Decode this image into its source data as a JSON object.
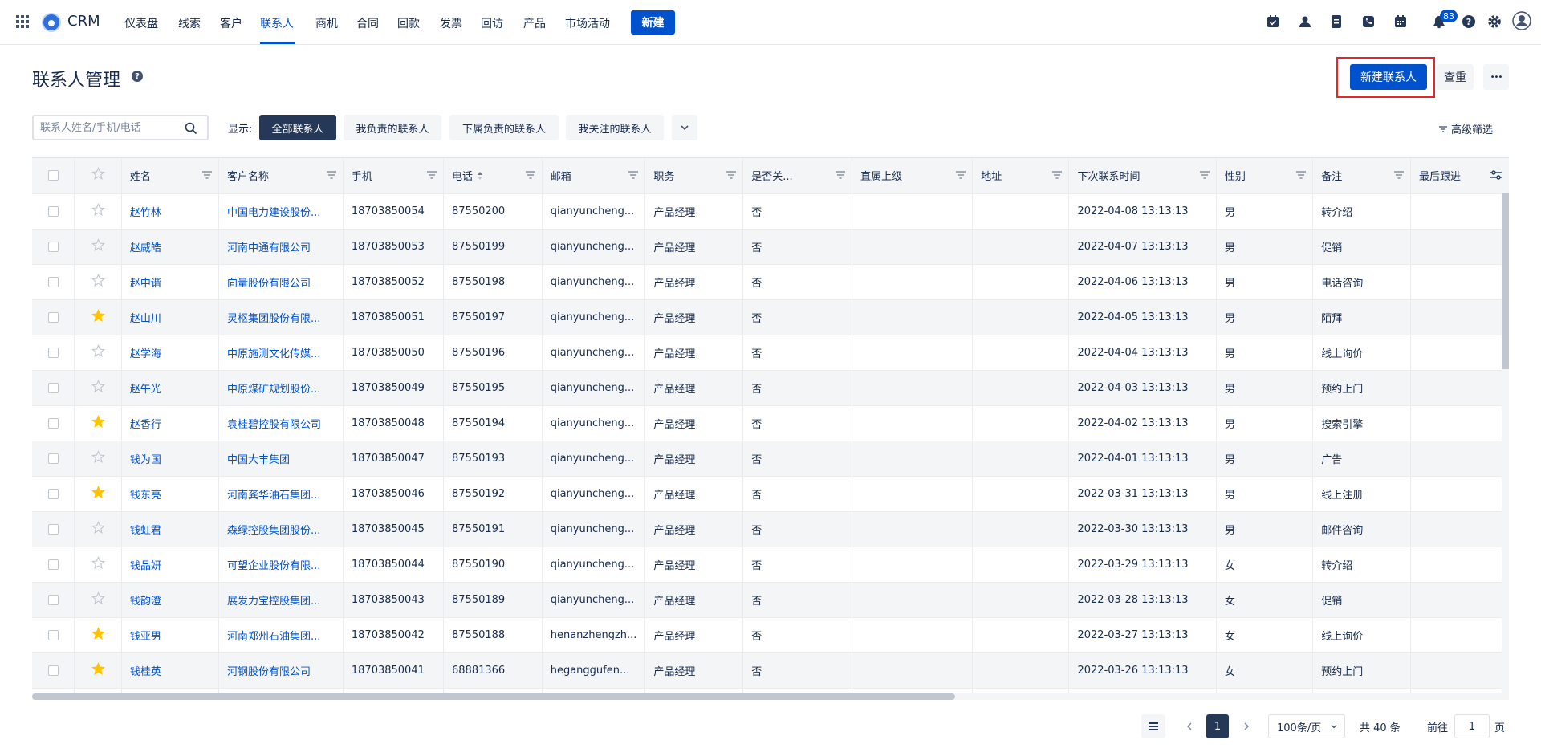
{
  "nav": {
    "brand": "CRM",
    "items": [
      "仪表盘",
      "线索",
      "客户",
      "联系人",
      "商机",
      "合同",
      "回款",
      "发票",
      "回访",
      "产品",
      "市场活动"
    ],
    "active_index": 3,
    "new_label": "新建",
    "notification_count": "83",
    "icons": [
      "task-icon",
      "contact-card-icon",
      "document-icon",
      "phone-icon",
      "calendar-icon",
      "bell-icon",
      "help-icon",
      "gear-icon",
      "user-avatar-icon"
    ]
  },
  "header": {
    "title": "联系人管理",
    "new_contact_label": "新建联系人",
    "check_dup_label": "查重",
    "more_label": "•••"
  },
  "filters": {
    "search_placeholder": "联系人姓名/手机/电话",
    "show_label": "显示:",
    "views": [
      "全部联系人",
      "我负责的联系人",
      "下属负责的联系人",
      "我关注的联系人"
    ],
    "active_view": 0,
    "advanced_label": "高级筛选"
  },
  "table": {
    "columns": [
      "姓名",
      "客户名称",
      "手机",
      "电话",
      "邮箱",
      "职务",
      "是否关...",
      "直属上级",
      "地址",
      "下次联系时间",
      "性别",
      "备注",
      "最后跟进"
    ],
    "rows": [
      {
        "starred": false,
        "name": "赵竹林",
        "customer": "中国电力建设股份...",
        "mobile": "18703850054",
        "phone": "87550200",
        "email": "qianyuncheng...",
        "title": "产品经理",
        "key": "否",
        "boss": "",
        "addr": "",
        "next": "2022-04-08 13:13:13",
        "gender": "男",
        "note": "转介绍"
      },
      {
        "starred": false,
        "name": "赵威皓",
        "customer": "河南中通有限公司",
        "mobile": "18703850053",
        "phone": "87550199",
        "email": "qianyuncheng...",
        "title": "产品经理",
        "key": "否",
        "boss": "",
        "addr": "",
        "next": "2022-04-07 13:13:13",
        "gender": "男",
        "note": "促销"
      },
      {
        "starred": false,
        "name": "赵中谐",
        "customer": "向量股份有限公司",
        "mobile": "18703850052",
        "phone": "87550198",
        "email": "qianyuncheng...",
        "title": "产品经理",
        "key": "否",
        "boss": "",
        "addr": "",
        "next": "2022-04-06 13:13:13",
        "gender": "男",
        "note": "电话咨询"
      },
      {
        "starred": true,
        "name": "赵山川",
        "customer": "灵枢集团股份有限...",
        "mobile": "18703850051",
        "phone": "87550197",
        "email": "qianyuncheng...",
        "title": "产品经理",
        "key": "否",
        "boss": "",
        "addr": "",
        "next": "2022-04-05 13:13:13",
        "gender": "男",
        "note": "陌拜"
      },
      {
        "starred": false,
        "name": "赵学海",
        "customer": "中原施测文化传媒...",
        "mobile": "18703850050",
        "phone": "87550196",
        "email": "qianyuncheng...",
        "title": "产品经理",
        "key": "否",
        "boss": "",
        "addr": "",
        "next": "2022-04-04 13:13:13",
        "gender": "男",
        "note": "线上询价"
      },
      {
        "starred": false,
        "name": "赵午光",
        "customer": "中原煤矿规划股份...",
        "mobile": "18703850049",
        "phone": "87550195",
        "email": "qianyuncheng...",
        "title": "产品经理",
        "key": "否",
        "boss": "",
        "addr": "",
        "next": "2022-04-03 13:13:13",
        "gender": "男",
        "note": "预约上门"
      },
      {
        "starred": true,
        "name": "赵香行",
        "customer": "袁桂碧控股有限公司",
        "mobile": "18703850048",
        "phone": "87550194",
        "email": "qianyuncheng...",
        "title": "产品经理",
        "key": "否",
        "boss": "",
        "addr": "",
        "next": "2022-04-02 13:13:13",
        "gender": "男",
        "note": "搜索引擎"
      },
      {
        "starred": false,
        "name": "钱为国",
        "customer": "中国大丰集团",
        "mobile": "18703850047",
        "phone": "87550193",
        "email": "qianyuncheng...",
        "title": "产品经理",
        "key": "否",
        "boss": "",
        "addr": "",
        "next": "2022-04-01 13:13:13",
        "gender": "男",
        "note": "广告"
      },
      {
        "starred": true,
        "name": "钱东亮",
        "customer": "河南龚华油石集团...",
        "mobile": "18703850046",
        "phone": "87550192",
        "email": "qianyuncheng...",
        "title": "产品经理",
        "key": "否",
        "boss": "",
        "addr": "",
        "next": "2022-03-31 13:13:13",
        "gender": "男",
        "note": "线上注册"
      },
      {
        "starred": false,
        "name": "钱虹君",
        "customer": "森绿控股集团股份...",
        "mobile": "18703850045",
        "phone": "87550191",
        "email": "qianyuncheng...",
        "title": "产品经理",
        "key": "否",
        "boss": "",
        "addr": "",
        "next": "2022-03-30 13:13:13",
        "gender": "男",
        "note": "邮件咨询"
      },
      {
        "starred": false,
        "name": "钱品妍",
        "customer": "可望企业股份有限...",
        "mobile": "18703850044",
        "phone": "87550190",
        "email": "qianyuncheng...",
        "title": "产品经理",
        "key": "否",
        "boss": "",
        "addr": "",
        "next": "2022-03-29 13:13:13",
        "gender": "女",
        "note": "转介绍"
      },
      {
        "starred": false,
        "name": "钱韵澄",
        "customer": "展发力宝控股集团...",
        "mobile": "18703850043",
        "phone": "87550189",
        "email": "qianyuncheng...",
        "title": "产品经理",
        "key": "否",
        "boss": "",
        "addr": "",
        "next": "2022-03-28 13:13:13",
        "gender": "女",
        "note": "促销"
      },
      {
        "starred": true,
        "name": "钱亚男",
        "customer": "河南郑州石油集团...",
        "mobile": "18703850042",
        "phone": "87550188",
        "email": "henanzhengzh...",
        "title": "产品经理",
        "key": "否",
        "boss": "",
        "addr": "",
        "next": "2022-03-27 13:13:13",
        "gender": "女",
        "note": "线上询价"
      },
      {
        "starred": true,
        "name": "钱桂英",
        "customer": "河钢股份有限公司",
        "mobile": "18703850041",
        "phone": "68881366",
        "email": "heganggufen...",
        "title": "产品经理",
        "key": "否",
        "boss": "",
        "addr": "",
        "next": "2022-03-26 13:13:13",
        "gender": "女",
        "note": "预约上门"
      },
      {
        "starred": false,
        "name": "",
        "customer": "",
        "mobile": "",
        "phone": "",
        "email": "",
        "title": "",
        "key": "",
        "boss": "",
        "addr": "",
        "next": "",
        "gender": "",
        "note": ""
      }
    ]
  },
  "pagination": {
    "current_page": "1",
    "page_size": "100条/页",
    "total": "共 40 条",
    "goto_prefix": "前往",
    "goto_value": "1",
    "goto_suffix": "页"
  },
  "colors": {
    "primary": "#0052cc",
    "star_on": "#ffc400",
    "highlight": "#e5262a"
  }
}
